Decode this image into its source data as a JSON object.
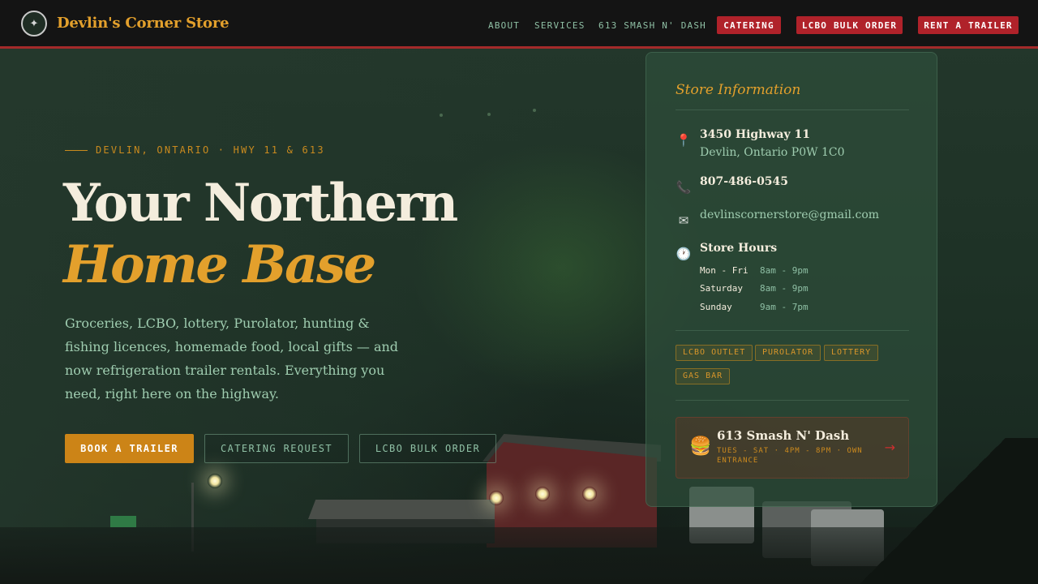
{
  "header": {
    "logo_glyph": "✦",
    "brand": "Devlin's Corner Store",
    "nav_links": [
      "ABOUT",
      "SERVICES",
      "613 SMASH N' DASH"
    ],
    "nav_buttons": [
      "CATERING",
      "LCBO BULK ORDER",
      "RENT A TRAILER"
    ]
  },
  "hero": {
    "eyebrow": "DEVLIN, ONTARIO · HWY 11 & 613",
    "title_line1": "Your Northern",
    "title_line2": "Home Base",
    "description": "Groceries, LCBO, lottery, Purolator, hunting & fishing licences, homemade food, local gifts — and now refrigeration trailer rentals. Everything you need, right here on the highway.",
    "buttons": {
      "primary": "BOOK A TRAILER",
      "catering": "CATERING REQUEST",
      "lcbo": "LCBO BULK ORDER"
    }
  },
  "store_info": {
    "title": "Store Information",
    "address_line1": "3450 Highway 11",
    "address_line2": "Devlin, Ontario P0W 1C0",
    "phone": "807-486-0545",
    "email": "devlinscornerstore@gmail.com",
    "hours_title": "Store Hours",
    "hours": [
      {
        "day": "Mon - Fri",
        "time": "8am - 9pm"
      },
      {
        "day": "Saturday",
        "time": "8am - 9pm"
      },
      {
        "day": "Sunday",
        "time": "9am - 7pm"
      }
    ],
    "tags": [
      "LCBO OUTLET",
      "PUROLATOR",
      "LOTTERY",
      "GAS BAR"
    ],
    "promo": {
      "emoji": "🍔",
      "title": "613 Smash N' Dash",
      "subtitle": "TUES - SAT · 4PM - 8PM · OWN ENTRANCE",
      "arrow": "→"
    },
    "icons": [
      "map-pin-icon",
      "phone-icon",
      "envelope-icon",
      "clock-icon"
    ]
  },
  "colors": {
    "accent_gold": "#e3a02c",
    "brand_red": "#b0222a",
    "header_bg": "#141414",
    "mint_text": "#9fcdb0"
  }
}
